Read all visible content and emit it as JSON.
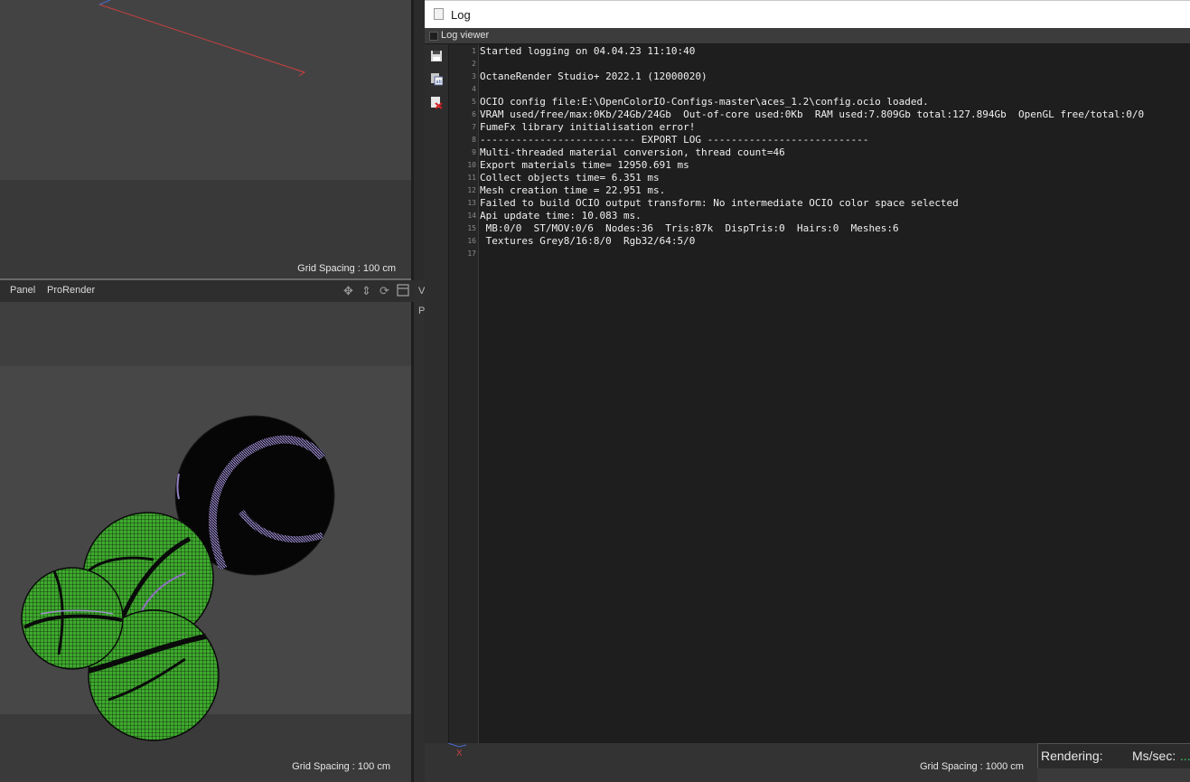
{
  "viewports": {
    "top": {
      "grid_spacing": "Grid Spacing : 100 cm"
    },
    "bottom": {
      "menu": [
        "Panel",
        "ProRender"
      ],
      "grid_spacing": "Grid Spacing : 100 cm"
    },
    "right": {
      "axis_label": "X",
      "grid_spacing": "Grid Spacing : 1000 cm"
    },
    "mid_strip_chars": [
      "V",
      "P"
    ]
  },
  "log_window": {
    "title": "Log",
    "subheader": "Log viewer",
    "side_tools": [
      "save-icon",
      "copy-icon",
      "clear-log-icon"
    ],
    "lines": [
      {
        "num": "1",
        "text": "Started logging on 04.04.23 11:10:40"
      },
      {
        "num": "2",
        "text": ""
      },
      {
        "num": "3",
        "text": "OctaneRender Studio+ 2022.1 (12000020)"
      },
      {
        "num": "4",
        "text": ""
      },
      {
        "num": "5",
        "text": "OCIO config file:E:\\OpenColorIO-Configs-master\\aces_1.2\\config.ocio loaded."
      },
      {
        "num": "6",
        "text": "VRAM used/free/max:0Kb/24Gb/24Gb  Out-of-core used:0Kb  RAM used:7.809Gb total:127.894Gb  OpenGL free/total:0/0"
      },
      {
        "num": "7",
        "text": "FumeFx library initialisation error!"
      },
      {
        "num": "8",
        "text": "-------------------------- EXPORT LOG ---------------------------"
      },
      {
        "num": "9",
        "text": "Multi-threaded material conversion, thread count=46"
      },
      {
        "num": "10",
        "text": "Export materials time= 12950.691 ms"
      },
      {
        "num": "11",
        "text": "Collect objects time= 6.351 ms"
      },
      {
        "num": "12",
        "text": "Mesh creation time = 22.951 ms."
      },
      {
        "num": "13",
        "text": "Failed to build OCIO output transform: No intermediate OCIO color space selected"
      },
      {
        "num": "14",
        "text": "Api update time: 10.083 ms."
      },
      {
        "num": "15",
        "text": " MB:0/0  ST/MOV:0/6  Nodes:36  Tris:87k  DispTris:0  Hairs:0  Meshes:6"
      },
      {
        "num": "16",
        "text": " Textures Grey8/16:8/0  Rgb32/64:5/0"
      },
      {
        "num": "17",
        "text": ""
      }
    ]
  },
  "status": {
    "rendering": "Rendering:",
    "ms_sec": "Ms/sec:",
    "ms_sec_value": "..."
  },
  "colors": {
    "axis_red": "#c84040",
    "axis_blue": "#4a6ad0",
    "sphere_green": "#3faa2e",
    "sphere_black": "#060606",
    "status_value": "#3fd06a"
  }
}
